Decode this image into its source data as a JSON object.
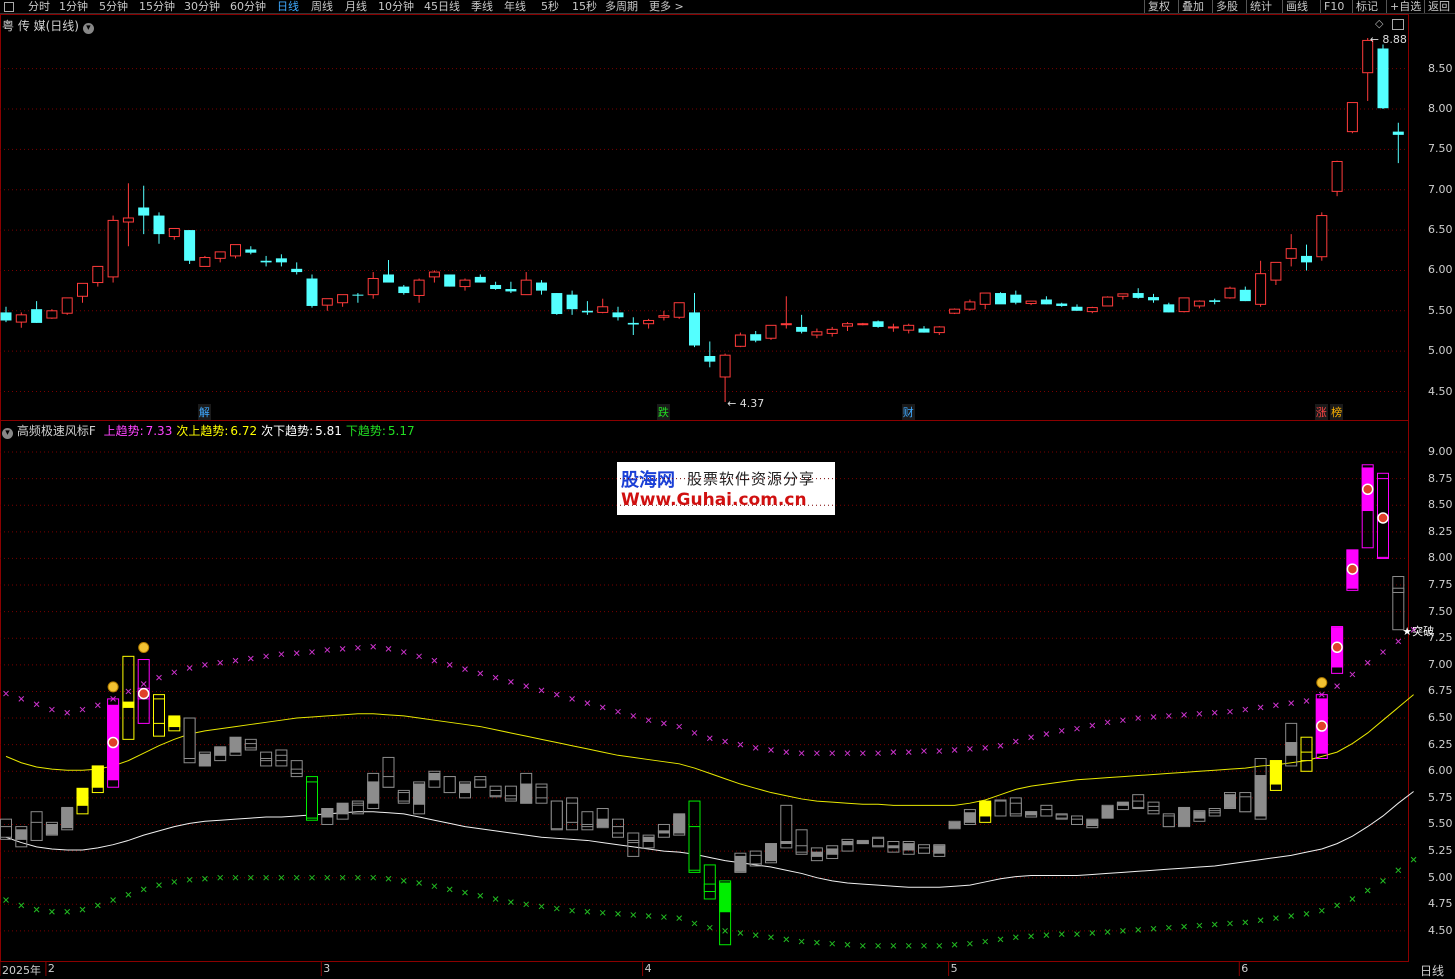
{
  "toolbar": {
    "items": [
      "分时",
      "1分钟",
      "5分钟",
      "15分钟",
      "30分钟",
      "60分钟",
      "日线",
      "周线",
      "月线",
      "10分钟",
      "45日线",
      "季线",
      "年线",
      "5秒",
      "15秒",
      "多周期",
      "更多 >"
    ],
    "active_index": 6,
    "right_items": [
      "复权",
      "叠加",
      "多股",
      "统计",
      "画线",
      "F10",
      "标记",
      "+自选",
      "返回"
    ]
  },
  "main_panel": {
    "title": "粤 传 媒(日线)",
    "high_label": "8.88",
    "low_label": "4.37",
    "event_tags": [
      {
        "text": "解",
        "color": "#3fa9ff",
        "day": 13
      },
      {
        "text": "跌",
        "color": "#22dd22",
        "day": 43
      },
      {
        "text": "财",
        "color": "#3fa9ff",
        "day": 59
      },
      {
        "text": "涨",
        "color": "#ff4444",
        "day": 86
      },
      {
        "text": "榜",
        "color": "#ffb400",
        "day": 87
      }
    ]
  },
  "indicator_panel": {
    "name": "高频极速风标F",
    "labels": [
      {
        "text": "上趋势:",
        "value": "7.33",
        "color": "#ff44ff"
      },
      {
        "text": "次上趋势:",
        "value": "6.72",
        "color": "#ffff00"
      },
      {
        "text": "次下趋势:",
        "value": "5.81",
        "color": "#ffffff"
      },
      {
        "text": "下趋势:",
        "value": "5.17",
        "color": "#22dd22"
      }
    ],
    "breakout_label": "突破"
  },
  "watermark": {
    "line1": "股海网",
    "line2": "股票软件资源分享",
    "line3": "Www.Guhai.com.cn"
  },
  "bottom": {
    "period_label": "日线"
  },
  "colors": {
    "up": "#ff3b3b",
    "down": "#54ffff",
    "grid": "#8b0000",
    "magenta": "#ff00ff",
    "yellow": "#ffff00",
    "green": "#00ee00",
    "gray": "#8c8c8c"
  },
  "chart_data": [
    {
      "type": "candlestick",
      "title": "粤 传 媒(日线)",
      "ylim": [
        4.3,
        8.95
      ],
      "yticks": [
        4.5,
        5.0,
        5.5,
        6.0,
        6.5,
        7.0,
        7.5,
        8.0,
        8.5
      ],
      "x_labels": [
        {
          "text": "2025年",
          "day": 1
        },
        {
          "text": "2",
          "day": 3
        },
        {
          "text": "3",
          "day": 21
        },
        {
          "text": "4",
          "day": 42
        },
        {
          "text": "5",
          "day": 62
        },
        {
          "text": "6",
          "day": 81
        }
      ],
      "ohlc": [
        [
          5.48,
          5.55,
          5.36,
          5.38
        ],
        [
          5.36,
          5.48,
          5.29,
          5.45
        ],
        [
          5.52,
          5.62,
          5.35,
          5.35
        ],
        [
          5.41,
          5.52,
          5.4,
          5.5
        ],
        [
          5.47,
          5.65,
          5.45,
          5.66
        ],
        [
          5.68,
          5.82,
          5.6,
          5.84
        ],
        [
          5.85,
          6.05,
          5.8,
          6.05
        ],
        [
          5.92,
          6.68,
          5.85,
          6.62
        ],
        [
          6.6,
          7.08,
          6.3,
          6.65
        ],
        [
          6.78,
          7.05,
          6.45,
          6.68
        ],
        [
          6.68,
          6.72,
          6.33,
          6.45
        ],
        [
          6.42,
          6.5,
          6.38,
          6.52
        ],
        [
          6.5,
          6.5,
          6.08,
          6.12
        ],
        [
          6.05,
          6.18,
          6.05,
          6.16
        ],
        [
          6.15,
          6.22,
          6.1,
          6.23
        ],
        [
          6.18,
          6.3,
          6.15,
          6.32
        ],
        [
          6.26,
          6.3,
          6.2,
          6.22
        ],
        [
          6.12,
          6.18,
          6.05,
          6.1
        ],
        [
          6.15,
          6.2,
          6.05,
          6.1
        ],
        [
          6.02,
          6.1,
          5.95,
          5.98
        ],
        [
          5.9,
          5.95,
          5.54,
          5.56
        ],
        [
          5.57,
          5.65,
          5.5,
          5.65
        ],
        [
          5.6,
          5.68,
          5.55,
          5.7
        ],
        [
          5.7,
          5.72,
          5.6,
          5.69
        ],
        [
          5.7,
          5.98,
          5.65,
          5.9
        ],
        [
          5.95,
          6.13,
          5.85,
          5.85
        ],
        [
          5.8,
          5.82,
          5.7,
          5.72
        ],
        [
          5.69,
          5.9,
          5.6,
          5.88
        ],
        [
          5.92,
          6.0,
          5.85,
          5.98
        ],
        [
          5.95,
          5.95,
          5.8,
          5.8
        ],
        [
          5.8,
          5.9,
          5.75,
          5.88
        ],
        [
          5.92,
          5.95,
          5.85,
          5.85
        ],
        [
          5.82,
          5.86,
          5.76,
          5.77
        ],
        [
          5.77,
          5.86,
          5.72,
          5.74
        ],
        [
          5.7,
          5.98,
          5.7,
          5.88
        ],
        [
          5.85,
          5.88,
          5.7,
          5.75
        ],
        [
          5.72,
          5.72,
          5.45,
          5.46
        ],
        [
          5.7,
          5.75,
          5.45,
          5.52
        ],
        [
          5.5,
          5.62,
          5.45,
          5.48
        ],
        [
          5.48,
          5.65,
          5.47,
          5.55
        ],
        [
          5.48,
          5.55,
          5.38,
          5.42
        ],
        [
          5.35,
          5.42,
          5.2,
          5.33
        ],
        [
          5.34,
          5.4,
          5.28,
          5.38
        ],
        [
          5.42,
          5.5,
          5.38,
          5.44
        ],
        [
          5.42,
          5.58,
          5.4,
          5.6
        ],
        [
          5.48,
          5.72,
          5.05,
          5.07
        ],
        [
          4.94,
          5.12,
          4.8,
          4.87
        ],
        [
          4.68,
          4.97,
          4.37,
          4.95
        ],
        [
          5.06,
          5.23,
          5.05,
          5.2
        ],
        [
          5.21,
          5.25,
          5.11,
          5.13
        ],
        [
          5.16,
          5.32,
          5.14,
          5.32
        ],
        [
          5.33,
          5.68,
          5.28,
          5.34
        ],
        [
          5.3,
          5.45,
          5.22,
          5.24
        ],
        [
          5.2,
          5.28,
          5.16,
          5.24
        ],
        [
          5.22,
          5.3,
          5.18,
          5.27
        ],
        [
          5.31,
          5.36,
          5.25,
          5.34
        ],
        [
          5.33,
          5.35,
          5.32,
          5.34
        ],
        [
          5.37,
          5.38,
          5.29,
          5.3
        ],
        [
          5.29,
          5.34,
          5.24,
          5.3
        ],
        [
          5.26,
          5.34,
          5.22,
          5.32
        ],
        [
          5.28,
          5.31,
          5.23,
          5.23
        ],
        [
          5.23,
          5.31,
          5.2,
          5.3
        ],
        [
          5.47,
          5.53,
          5.46,
          5.52
        ],
        [
          5.52,
          5.64,
          5.5,
          5.61
        ],
        [
          5.58,
          5.7,
          5.52,
          5.72
        ],
        [
          5.72,
          5.73,
          5.6,
          5.58
        ],
        [
          5.7,
          5.75,
          5.58,
          5.6
        ],
        [
          5.59,
          5.62,
          5.57,
          5.62
        ],
        [
          5.64,
          5.68,
          5.58,
          5.58
        ],
        [
          5.59,
          5.6,
          5.55,
          5.56
        ],
        [
          5.55,
          5.58,
          5.5,
          5.5
        ],
        [
          5.49,
          5.55,
          5.47,
          5.54
        ],
        [
          5.56,
          5.68,
          5.56,
          5.67
        ],
        [
          5.68,
          5.7,
          5.64,
          5.71
        ],
        [
          5.72,
          5.78,
          5.65,
          5.66
        ],
        [
          5.67,
          5.71,
          5.6,
          5.63
        ],
        [
          5.58,
          5.6,
          5.48,
          5.48
        ],
        [
          5.49,
          5.65,
          5.48,
          5.66
        ],
        [
          5.56,
          5.63,
          5.53,
          5.62
        ],
        [
          5.63,
          5.65,
          5.58,
          5.61
        ],
        [
          5.66,
          5.8,
          5.65,
          5.78
        ],
        [
          5.76,
          5.8,
          5.62,
          5.62
        ],
        [
          5.58,
          6.12,
          5.55,
          5.96
        ],
        [
          5.88,
          6.1,
          5.82,
          6.1
        ],
        [
          6.15,
          6.45,
          6.05,
          6.27
        ],
        [
          6.18,
          6.32,
          6.0,
          6.1
        ],
        [
          6.17,
          6.72,
          6.12,
          6.68
        ],
        [
          6.98,
          7.36,
          6.92,
          7.35
        ],
        [
          7.72,
          8.08,
          7.7,
          8.08
        ],
        [
          8.45,
          8.88,
          8.1,
          8.85
        ],
        [
          8.75,
          8.8,
          8.0,
          8.01
        ],
        [
          7.72,
          7.83,
          7.33,
          7.68
        ]
      ]
    },
    {
      "type": "indicator",
      "title": "高频极速风标F",
      "ylim": [
        4.4,
        9.1
      ],
      "yticks": [
        4.5,
        4.75,
        5.0,
        5.25,
        5.5,
        5.75,
        6.0,
        6.25,
        6.5,
        6.75,
        7.0,
        7.25,
        7.5,
        7.75,
        8.0,
        8.25,
        8.5,
        8.75,
        9.0
      ],
      "series": [
        {
          "name": "上趋势",
          "values": [
            6.73,
            6.68,
            6.63,
            6.58,
            6.55,
            6.58,
            6.62,
            6.68,
            6.75,
            6.82,
            6.88,
            6.93,
            6.97,
            7.0,
            7.02,
            7.04,
            7.06,
            7.08,
            7.1,
            7.11,
            7.12,
            7.14,
            7.15,
            7.16,
            7.17,
            7.15,
            7.12,
            7.08,
            7.04,
            7.0,
            6.96,
            6.92,
            6.88,
            6.84,
            6.8,
            6.76,
            6.72,
            6.68,
            6.64,
            6.6,
            6.56,
            6.52,
            6.48,
            6.45,
            6.42,
            6.36,
            6.31,
            6.28,
            6.25,
            6.22,
            6.2,
            6.18,
            6.17,
            6.17,
            6.17,
            6.17,
            6.17,
            6.17,
            6.18,
            6.18,
            6.19,
            6.19,
            6.2,
            6.21,
            6.22,
            6.24,
            6.28,
            6.32,
            6.35,
            6.38,
            6.4,
            6.43,
            6.46,
            6.48,
            6.5,
            6.51,
            6.52,
            6.53,
            6.54,
            6.55,
            6.56,
            6.58,
            6.6,
            6.62,
            6.64,
            6.66,
            6.72,
            6.8,
            6.91,
            7.02,
            7.12,
            7.22,
            7.33
          ]
        },
        {
          "name": "次上趋势",
          "values": [
            6.14,
            6.08,
            6.04,
            6.02,
            6.01,
            6.01,
            6.02,
            6.05,
            6.1,
            6.17,
            6.24,
            6.3,
            6.35,
            6.38,
            6.4,
            6.42,
            6.44,
            6.46,
            6.48,
            6.5,
            6.51,
            6.52,
            6.53,
            6.54,
            6.54,
            6.53,
            6.52,
            6.5,
            6.48,
            6.46,
            6.44,
            6.42,
            6.39,
            6.36,
            6.33,
            6.3,
            6.27,
            6.24,
            6.21,
            6.18,
            6.15,
            6.13,
            6.11,
            6.09,
            6.07,
            6.03,
            5.98,
            5.93,
            5.88,
            5.84,
            5.8,
            5.77,
            5.74,
            5.72,
            5.71,
            5.7,
            5.69,
            5.69,
            5.68,
            5.68,
            5.68,
            5.68,
            5.68,
            5.7,
            5.73,
            5.78,
            5.83,
            5.86,
            5.88,
            5.9,
            5.92,
            5.93,
            5.94,
            5.95,
            5.96,
            5.97,
            5.98,
            5.99,
            6.0,
            6.01,
            6.02,
            6.03,
            6.05,
            6.06,
            6.08,
            6.1,
            6.14,
            6.18,
            6.26,
            6.36,
            6.48,
            6.6,
            6.72
          ]
        },
        {
          "name": "次下趋势",
          "values": [
            5.38,
            5.33,
            5.29,
            5.27,
            5.26,
            5.26,
            5.28,
            5.31,
            5.35,
            5.4,
            5.44,
            5.48,
            5.51,
            5.53,
            5.54,
            5.55,
            5.56,
            5.57,
            5.57,
            5.58,
            5.59,
            5.6,
            5.61,
            5.62,
            5.62,
            5.61,
            5.6,
            5.57,
            5.54,
            5.51,
            5.48,
            5.46,
            5.44,
            5.42,
            5.4,
            5.38,
            5.37,
            5.36,
            5.35,
            5.33,
            5.31,
            5.29,
            5.27,
            5.25,
            5.24,
            5.22,
            5.19,
            5.16,
            5.14,
            5.12,
            5.1,
            5.07,
            5.04,
            5.0,
            4.97,
            4.95,
            4.94,
            4.93,
            4.92,
            4.91,
            4.91,
            4.91,
            4.92,
            4.93,
            4.96,
            4.99,
            5.01,
            5.02,
            5.02,
            5.02,
            5.02,
            5.03,
            5.04,
            5.05,
            5.06,
            5.07,
            5.08,
            5.09,
            5.1,
            5.11,
            5.13,
            5.15,
            5.17,
            5.19,
            5.21,
            5.24,
            5.27,
            5.32,
            5.39,
            5.48,
            5.58,
            5.7,
            5.81
          ]
        },
        {
          "name": "下趋势",
          "values": [
            4.79,
            4.74,
            4.7,
            4.68,
            4.68,
            4.7,
            4.74,
            4.79,
            4.84,
            4.89,
            4.93,
            4.96,
            4.98,
            4.99,
            5.0,
            5.0,
            5.0,
            5.0,
            5.0,
            5.0,
            5.0,
            5.0,
            5.0,
            5.0,
            5.0,
            4.99,
            4.97,
            4.95,
            4.92,
            4.89,
            4.86,
            4.83,
            4.8,
            4.77,
            4.75,
            4.73,
            4.71,
            4.69,
            4.68,
            4.67,
            4.66,
            4.65,
            4.64,
            4.63,
            4.62,
            4.57,
            4.53,
            4.5,
            4.48,
            4.46,
            4.44,
            4.42,
            4.4,
            4.39,
            4.38,
            4.37,
            4.36,
            4.36,
            4.36,
            4.36,
            4.36,
            4.36,
            4.37,
            4.38,
            4.4,
            4.42,
            4.44,
            4.45,
            4.46,
            4.47,
            4.47,
            4.48,
            4.49,
            4.5,
            4.51,
            4.52,
            4.53,
            4.54,
            4.55,
            4.56,
            4.57,
            4.58,
            4.6,
            4.62,
            4.64,
            4.66,
            4.69,
            4.74,
            4.8,
            4.88,
            4.97,
            5.07,
            5.17
          ]
        }
      ],
      "bar_colors": [
        "g",
        "g",
        "g",
        "g",
        "g",
        "y",
        "y",
        "m",
        "y",
        "m",
        "y",
        "y",
        "g",
        "g",
        "g",
        "g",
        "g",
        "g",
        "g",
        "g",
        "gr",
        "g",
        "g",
        "g",
        "g",
        "g",
        "g",
        "g",
        "g",
        "g",
        "g",
        "g",
        "g",
        "g",
        "g",
        "g",
        "g",
        "g",
        "g",
        "g",
        "g",
        "g",
        "g",
        "g",
        "g",
        "gr",
        "gr",
        "gr",
        "g",
        "g",
        "g",
        "g",
        "g",
        "g",
        "g",
        "g",
        "g",
        "g",
        "g",
        "g",
        "g",
        "g",
        "g",
        "g",
        "y",
        "g",
        "g",
        "g",
        "g",
        "g",
        "g",
        "g",
        "g",
        "g",
        "g",
        "g",
        "g",
        "g",
        "g",
        "g",
        "g",
        "g",
        "g",
        "y",
        "g",
        "y",
        "m",
        "m",
        "m",
        "m",
        "m"
      ],
      "money_bag_days": [
        7,
        9,
        86
      ],
      "signal_dot_days": [
        7,
        9,
        86,
        87,
        88,
        89,
        90
      ]
    }
  ]
}
